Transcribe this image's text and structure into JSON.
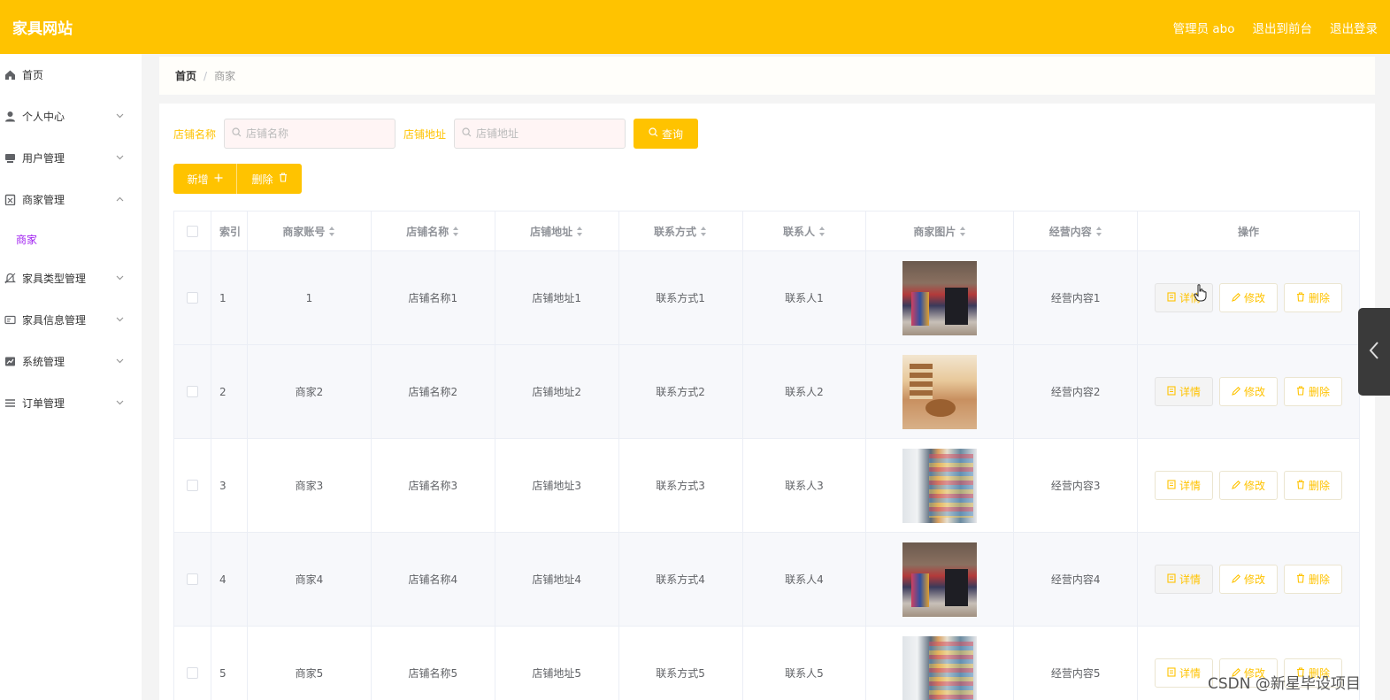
{
  "header": {
    "brand": "家具网站",
    "admin_label": "管理员 abo",
    "to_front_label": "退出到前台",
    "logout_label": "退出登录",
    "accent_color": "#ffc300"
  },
  "sidebar": {
    "items": [
      {
        "label": "首页",
        "icon": "home-icon"
      },
      {
        "label": "个人中心",
        "icon": "user-icon"
      },
      {
        "label": "用户管理",
        "icon": "users-icon"
      },
      {
        "label": "商家管理",
        "icon": "clipboard-icon"
      },
      {
        "label": "家具类型管理",
        "icon": "bell-icon"
      },
      {
        "label": "家具信息管理",
        "icon": "card-icon"
      },
      {
        "label": "系统管理",
        "icon": "chart-icon"
      },
      {
        "label": "订单管理",
        "icon": "list-icon"
      }
    ],
    "active_sub": "商家"
  },
  "breadcrumb": {
    "home": "首页",
    "separator": "/",
    "current": "商家"
  },
  "search": {
    "shop_name_label": "店铺名称",
    "shop_name_placeholder": "店铺名称",
    "shop_address_label": "店铺地址",
    "shop_address_placeholder": "店铺地址",
    "query_label": "查询"
  },
  "actions": {
    "add_label": "新增",
    "delete_label": "删除"
  },
  "table": {
    "columns": [
      "索引",
      "商家账号",
      "店铺名称",
      "店铺地址",
      "联系方式",
      "联系人",
      "商家图片",
      "经营内容",
      "操作"
    ],
    "rows": [
      {
        "index": "1",
        "account": "1",
        "shop_name": "店铺名称1",
        "shop_address": "店铺地址1",
        "contact": "联系方式1",
        "person": "联系人1",
        "image": "storefront",
        "business": "经营内容1"
      },
      {
        "index": "2",
        "account": "商家2",
        "shop_name": "店铺名称2",
        "shop_address": "店铺地址2",
        "contact": "联系方式2",
        "person": "联系人2",
        "image": "furniture-shop-interior",
        "business": "经营内容2"
      },
      {
        "index": "3",
        "account": "商家3",
        "shop_name": "店铺名称3",
        "shop_address": "店铺地址3",
        "contact": "联系方式3",
        "person": "联系人3",
        "image": "store-shelves",
        "business": "经营内容3"
      },
      {
        "index": "4",
        "account": "商家4",
        "shop_name": "店铺名称4",
        "shop_address": "店铺地址4",
        "contact": "联系方式4",
        "person": "联系人4",
        "image": "storefront",
        "business": "经营内容4"
      },
      {
        "index": "5",
        "account": "商家5",
        "shop_name": "店铺名称5",
        "shop_address": "店铺地址5",
        "contact": "联系方式5",
        "person": "联系人5",
        "image": "store-shelves",
        "business": "经营内容5"
      }
    ],
    "op_labels": {
      "detail": "详情",
      "edit": "修改",
      "delete": "删除"
    }
  },
  "watermark": "CSDN @新星毕设项目"
}
